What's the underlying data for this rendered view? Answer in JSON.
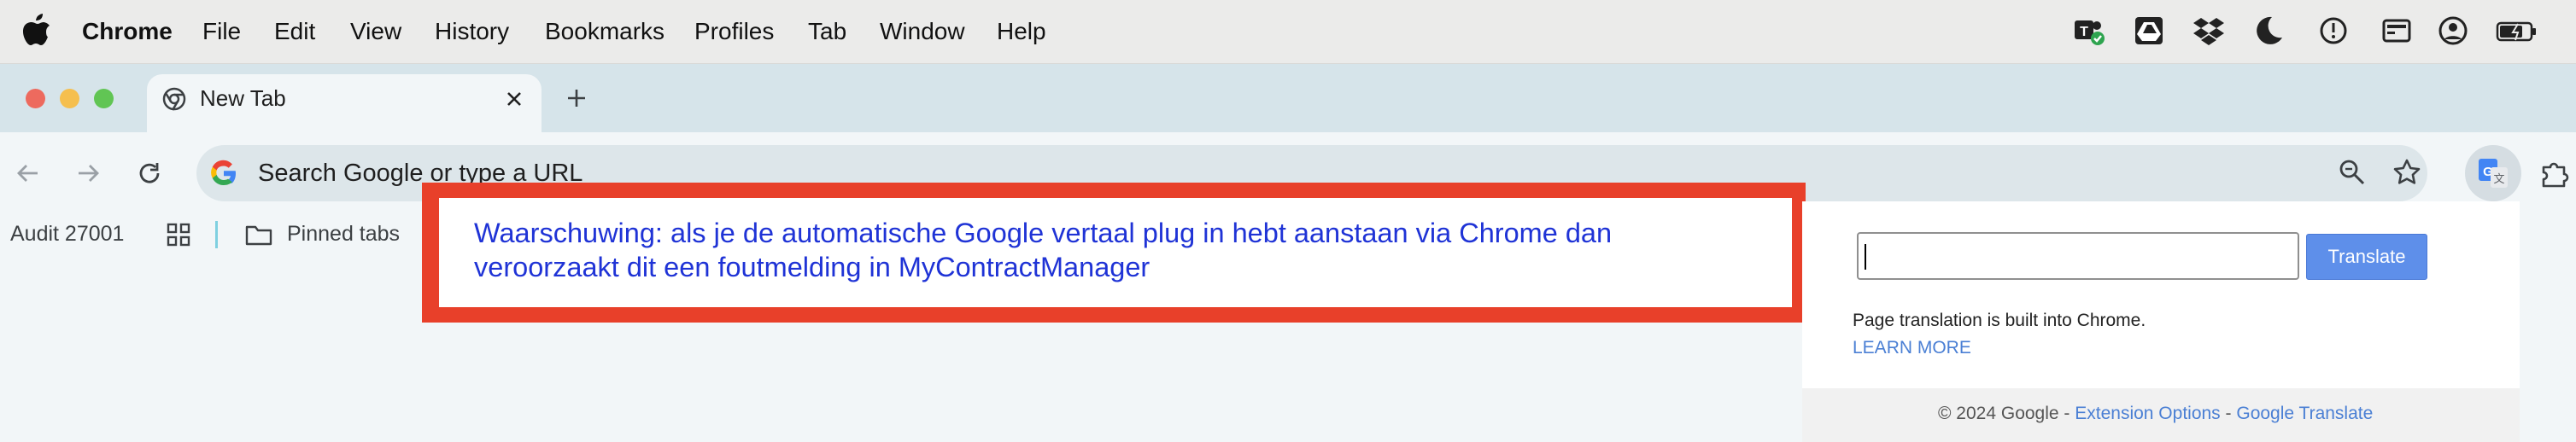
{
  "menubar": {
    "app_name": "Chrome",
    "items": [
      "File",
      "Edit",
      "View",
      "History",
      "Bookmarks",
      "Profiles",
      "Tab",
      "Window",
      "Help"
    ],
    "tray_icons": [
      "teams-icon",
      "google-drive-icon",
      "dropbox-icon",
      "moon-icon",
      "timer-icon",
      "display-icon",
      "user-circle-icon",
      "battery-icon"
    ]
  },
  "tabs": [
    {
      "title": "New Tab",
      "icon": "chrome-icon",
      "active": true
    }
  ],
  "toolbar": {
    "omnibox_placeholder": "Search Google or type a URL"
  },
  "bookmarks": {
    "items": [
      "Audit 27001",
      "Pinned tabs"
    ]
  },
  "banner": {
    "line1": "Waarschuwing: als je de automatische Google vertaal plug in hebt aanstaan via Chrome dan",
    "line2": "veroorzaakt dit een foutmelding in MyContractManager",
    "border_color": "#e8402a",
    "text_color": "#1f33d6"
  },
  "translate_popup": {
    "input_value": "",
    "button_label": "Translate",
    "info_text": "Page translation is built into Chrome.",
    "learn_more": "LEARN MORE",
    "footer_copyright": "© 2024 Google - ",
    "footer_link_options": "Extension Options",
    "footer_separator": " - ",
    "footer_link_translate": "Google Translate"
  },
  "colors": {
    "accent_blue": "#5e8fea",
    "link_blue": "#4a7fd4"
  }
}
